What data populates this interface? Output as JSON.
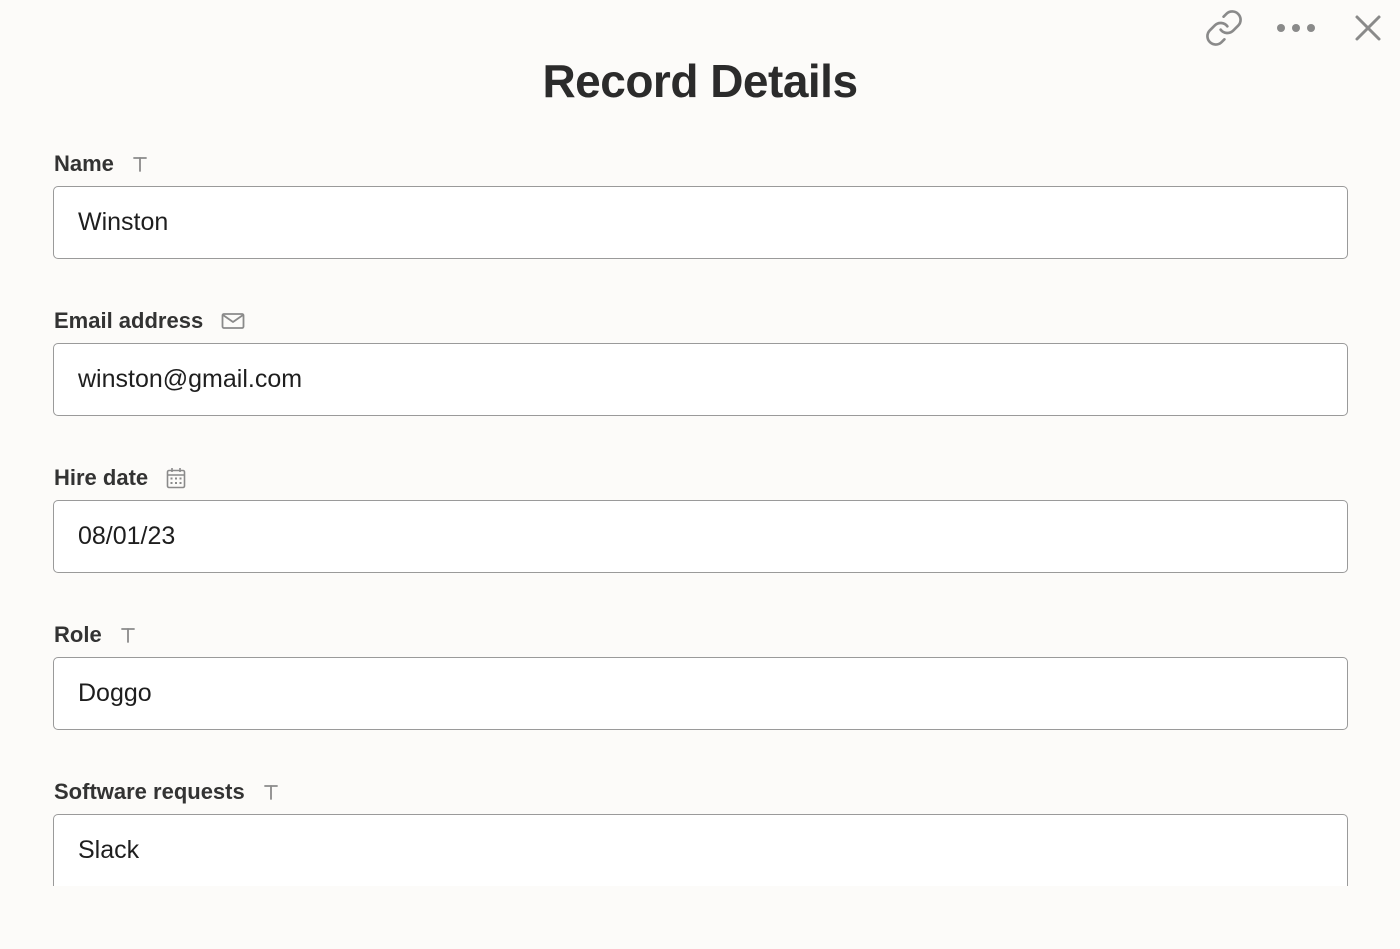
{
  "header": {
    "title": "Record Details",
    "actions": [
      {
        "name": "copy-link-button",
        "icon": "link-icon"
      },
      {
        "name": "more-options-button",
        "icon": "more-horizontal-icon"
      },
      {
        "name": "close-button",
        "icon": "close-icon"
      }
    ]
  },
  "fields": [
    {
      "label": "Name",
      "type_icon": "text-type-icon",
      "value": "Winston"
    },
    {
      "label": "Email address",
      "type_icon": "email-type-icon",
      "value": "winston@gmail.com"
    },
    {
      "label": "Hire date",
      "type_icon": "calendar-type-icon",
      "value": "08/01/23"
    },
    {
      "label": "Role",
      "type_icon": "text-type-icon",
      "value": "Doggo"
    },
    {
      "label": "Software requests",
      "type_icon": "text-type-icon",
      "value": "Slack"
    }
  ],
  "colors": {
    "background": "#fcfbf9",
    "input_border": "#9a9a9a",
    "icon": "#8a8a8a",
    "text": "#2a2a2a"
  }
}
